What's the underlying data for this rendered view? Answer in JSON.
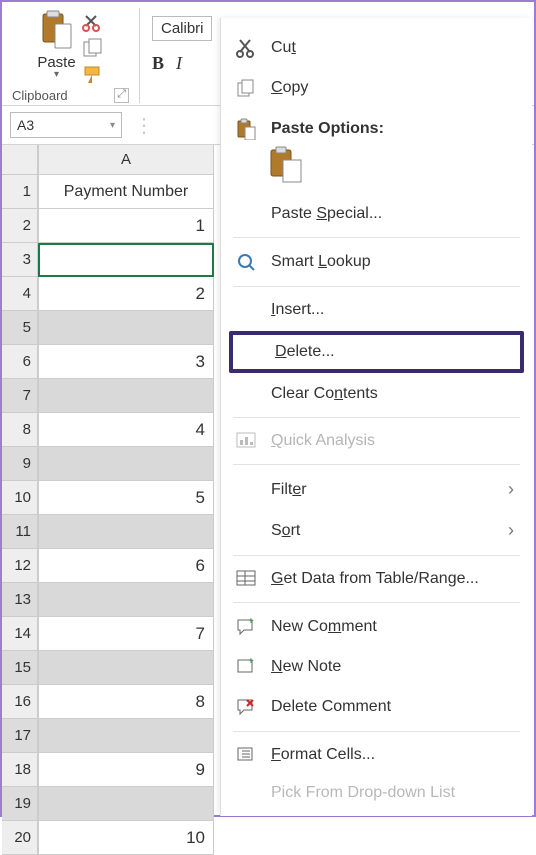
{
  "ribbon": {
    "paste_label": "Paste",
    "clipboard_group": "Clipboard",
    "font_name": "Calibri",
    "font_bold": "B",
    "font_italic": "I"
  },
  "namebox": {
    "value": "A3"
  },
  "grid": {
    "col_header": "A",
    "rows": [
      {
        "n": "1",
        "val": "Payment Number",
        "header": true
      },
      {
        "n": "2",
        "val": "1"
      },
      {
        "n": "3",
        "val": "",
        "active": true
      },
      {
        "n": "4",
        "val": "2"
      },
      {
        "n": "5",
        "val": "",
        "blank": true
      },
      {
        "n": "6",
        "val": "3"
      },
      {
        "n": "7",
        "val": "",
        "blank": true
      },
      {
        "n": "8",
        "val": "4"
      },
      {
        "n": "9",
        "val": "",
        "blank": true
      },
      {
        "n": "10",
        "val": "5"
      },
      {
        "n": "11",
        "val": "",
        "blank": true
      },
      {
        "n": "12",
        "val": "6"
      },
      {
        "n": "13",
        "val": "",
        "blank": true
      },
      {
        "n": "14",
        "val": "7"
      },
      {
        "n": "15",
        "val": "",
        "blank": true
      },
      {
        "n": "16",
        "val": "8"
      },
      {
        "n": "17",
        "val": "",
        "blank": true
      },
      {
        "n": "18",
        "val": "9"
      },
      {
        "n": "19",
        "val": "",
        "blank": true
      },
      {
        "n": "20",
        "val": "10"
      }
    ]
  },
  "menu": {
    "cut": "Cut",
    "copy": "Copy",
    "paste_options": "Paste Options:",
    "paste_special": "Paste Special...",
    "smart_lookup": "Smart Lookup",
    "insert": "Insert...",
    "delete": "Delete...",
    "clear_contents": "Clear Contents",
    "quick_analysis": "Quick Analysis",
    "filter": "Filter",
    "sort": "Sort",
    "get_data": "Get Data from Table/Range...",
    "new_comment": "New Comment",
    "new_note": "New Note",
    "delete_comment": "Delete Comment",
    "format_cells": "Format Cells...",
    "pick_list": "Pick From Drop-down List"
  }
}
